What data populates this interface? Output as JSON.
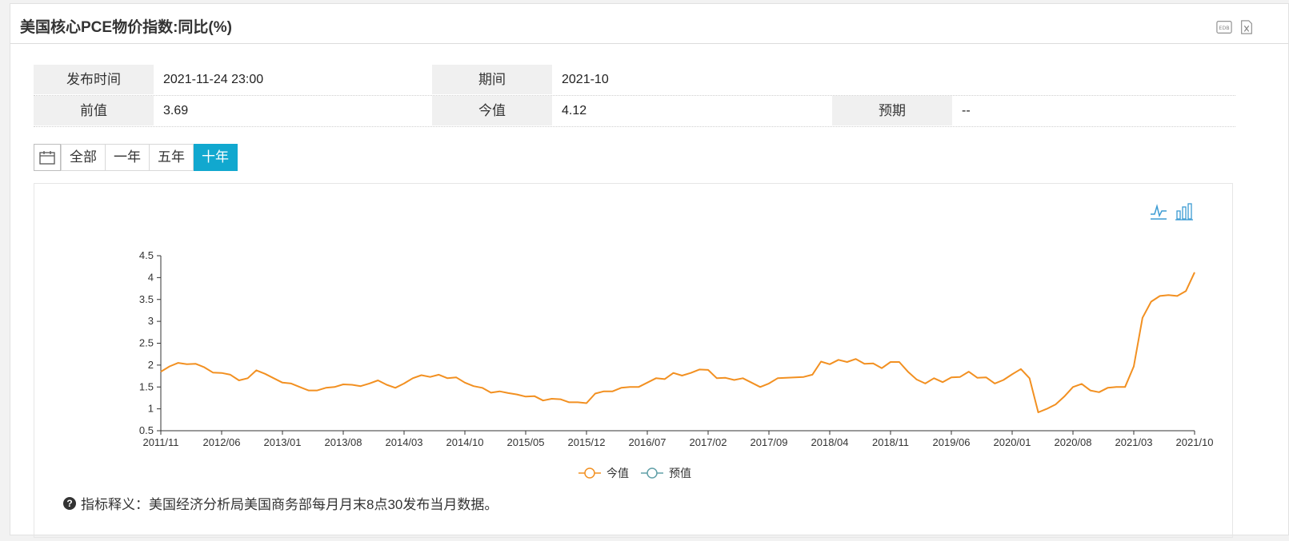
{
  "window": {
    "title": "美国核心PCE物价指数:同比(%)",
    "icons": [
      "edb-icon",
      "excel-export-icon"
    ]
  },
  "info": {
    "publish_time_label": "发布时间",
    "publish_time": "2021-11-24 23:00",
    "period_label": "期间",
    "period": "2021-10",
    "prev_label": "前值",
    "prev_value": "3.69",
    "current_label": "今值",
    "current_value": "4.12",
    "forecast_label": "预期",
    "forecast_value": "--"
  },
  "ranges": {
    "all": "全部",
    "one_year": "一年",
    "five_year": "五年",
    "ten_year": "十年",
    "active": "十年"
  },
  "chart_tools": [
    "line-chart-icon",
    "bar-chart-icon"
  ],
  "note": "指标释义：美国经济分析局美国商务部每月月末8点30发布当月数据。",
  "colors": {
    "series": "#f29021",
    "forecast": "#61a0a8",
    "accent": "#11a8cf"
  },
  "chart_data": {
    "type": "line",
    "x_start": "2011/11",
    "x_end": "2021/10",
    "x_ticks": [
      "2011/11",
      "2012/06",
      "2013/01",
      "2013/08",
      "2014/03",
      "2014/10",
      "2015/05",
      "2015/12",
      "2016/07",
      "2017/02",
      "2017/09",
      "2018/04",
      "2018/11",
      "2019/06",
      "2020/01",
      "2020/08",
      "2021/03",
      "2021/10"
    ],
    "ylim": [
      0.5,
      4.5
    ],
    "y_ticks": [
      "0.5",
      "1",
      "1.5",
      "2",
      "2.5",
      "3",
      "3.5",
      "4",
      "4.5"
    ],
    "legend": [
      "今值",
      "预值"
    ],
    "legend_position": "bottom-center",
    "series": [
      {
        "name": "今值",
        "values": [
          1.85,
          1.97,
          2.05,
          2.02,
          2.03,
          1.95,
          1.83,
          1.82,
          1.78,
          1.65,
          1.7,
          1.88,
          1.8,
          1.7,
          1.6,
          1.58,
          1.5,
          1.42,
          1.42,
          1.48,
          1.5,
          1.56,
          1.55,
          1.52,
          1.58,
          1.65,
          1.55,
          1.48,
          1.58,
          1.7,
          1.77,
          1.73,
          1.78,
          1.7,
          1.72,
          1.6,
          1.52,
          1.48,
          1.37,
          1.4,
          1.36,
          1.33,
          1.28,
          1.29,
          1.19,
          1.23,
          1.22,
          1.15,
          1.15,
          1.13,
          1.35,
          1.4,
          1.4,
          1.48,
          1.5,
          1.5,
          1.6,
          1.7,
          1.68,
          1.82,
          1.76,
          1.82,
          1.9,
          1.89,
          1.7,
          1.71,
          1.66,
          1.7,
          1.6,
          1.5,
          1.58,
          1.7,
          1.71,
          1.72,
          1.73,
          1.78,
          2.08,
          2.02,
          2.12,
          2.07,
          2.14,
          2.03,
          2.04,
          1.93,
          2.07,
          2.07,
          1.85,
          1.67,
          1.58,
          1.7,
          1.61,
          1.72,
          1.73,
          1.85,
          1.71,
          1.72,
          1.58,
          1.66,
          1.79,
          1.91,
          1.7,
          0.92,
          1.0,
          1.1,
          1.28,
          1.5,
          1.57,
          1.42,
          1.38,
          1.48,
          1.5,
          1.5,
          1.97,
          3.08,
          3.45,
          3.58,
          3.6,
          3.58,
          3.69,
          4.12
        ]
      },
      {
        "name": "预值",
        "values": []
      }
    ]
  }
}
